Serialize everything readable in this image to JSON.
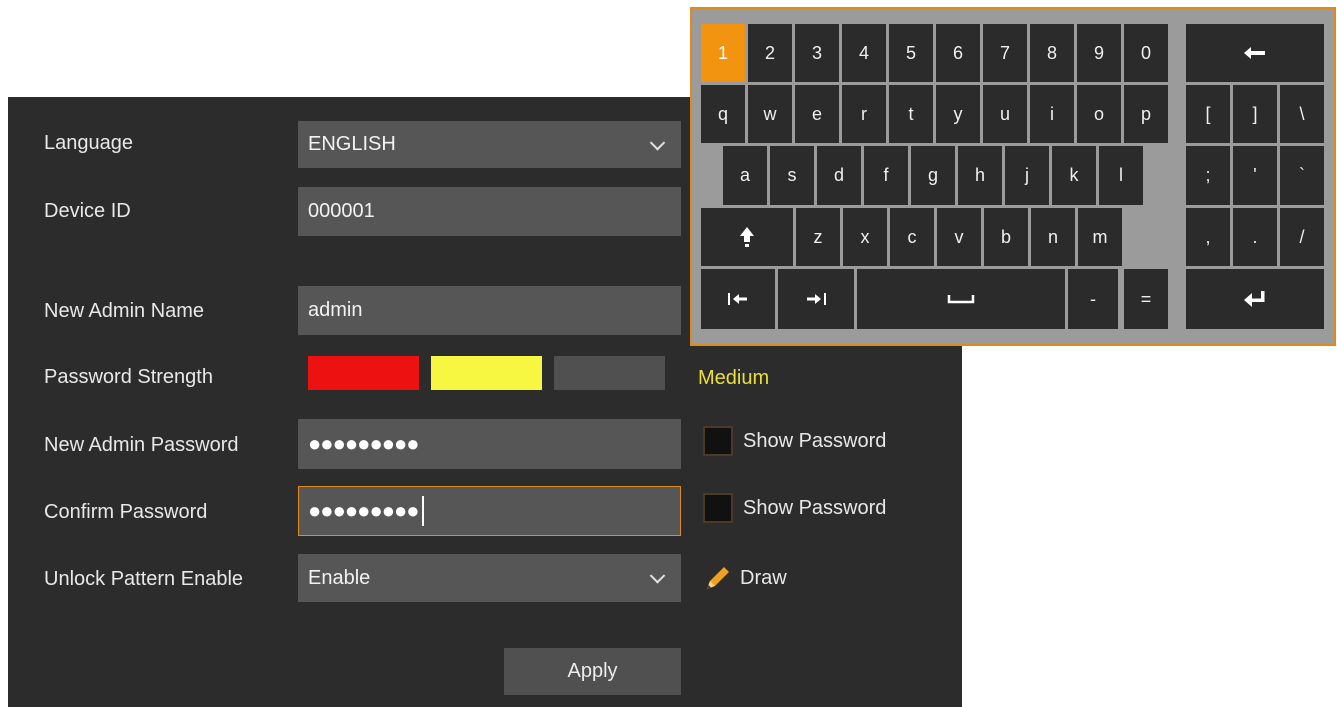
{
  "form": {
    "language": {
      "label": "Language",
      "value": "ENGLISH"
    },
    "device_id": {
      "label": "Device ID",
      "value": "000001"
    },
    "admin_name": {
      "label": "New Admin Name",
      "value": "admin"
    },
    "password_strength": {
      "label": "Password Strength",
      "level_text": "Medium",
      "bars": [
        "#ee1111",
        "#f7f742",
        "#505050"
      ]
    },
    "new_password": {
      "label": "New Admin Password",
      "value": "●●●●●●●●●",
      "show_label": "Show Password"
    },
    "confirm_password": {
      "label": "Confirm Password",
      "value": "●●●●●●●●●",
      "show_label": "Show Password"
    },
    "unlock_pattern": {
      "label": "Unlock Pattern Enable",
      "value": "Enable",
      "draw_label": "Draw"
    },
    "apply_label": "Apply"
  },
  "keyboard": {
    "row1": [
      "1",
      "2",
      "3",
      "4",
      "5",
      "6",
      "7",
      "8",
      "9",
      "0"
    ],
    "row2": [
      "q",
      "w",
      "e",
      "r",
      "t",
      "y",
      "u",
      "i",
      "o",
      "p"
    ],
    "row3": [
      "a",
      "s",
      "d",
      "f",
      "g",
      "h",
      "j",
      "k",
      "l"
    ],
    "row4": [
      "z",
      "x",
      "c",
      "v",
      "b",
      "n",
      "m"
    ],
    "row5": [
      "-",
      "="
    ],
    "symbols": [
      "[",
      "]",
      "\\",
      ";",
      "'",
      "`",
      ",",
      ".",
      "/"
    ],
    "active_key": "1",
    "icons": {
      "backspace": "backspace-arrow-icon",
      "shift": "shift-arrow-icon",
      "cursor_left": "cursor-left-icon",
      "cursor_right": "cursor-right-icon",
      "space": "space-bar-icon",
      "enter": "enter-return-icon"
    }
  },
  "colors": {
    "panel_bg": "#2c2c2c",
    "field_bg": "#565656",
    "accent": "#e08a1e",
    "active_key": "#f29410",
    "strength_text": "#e8e039"
  }
}
